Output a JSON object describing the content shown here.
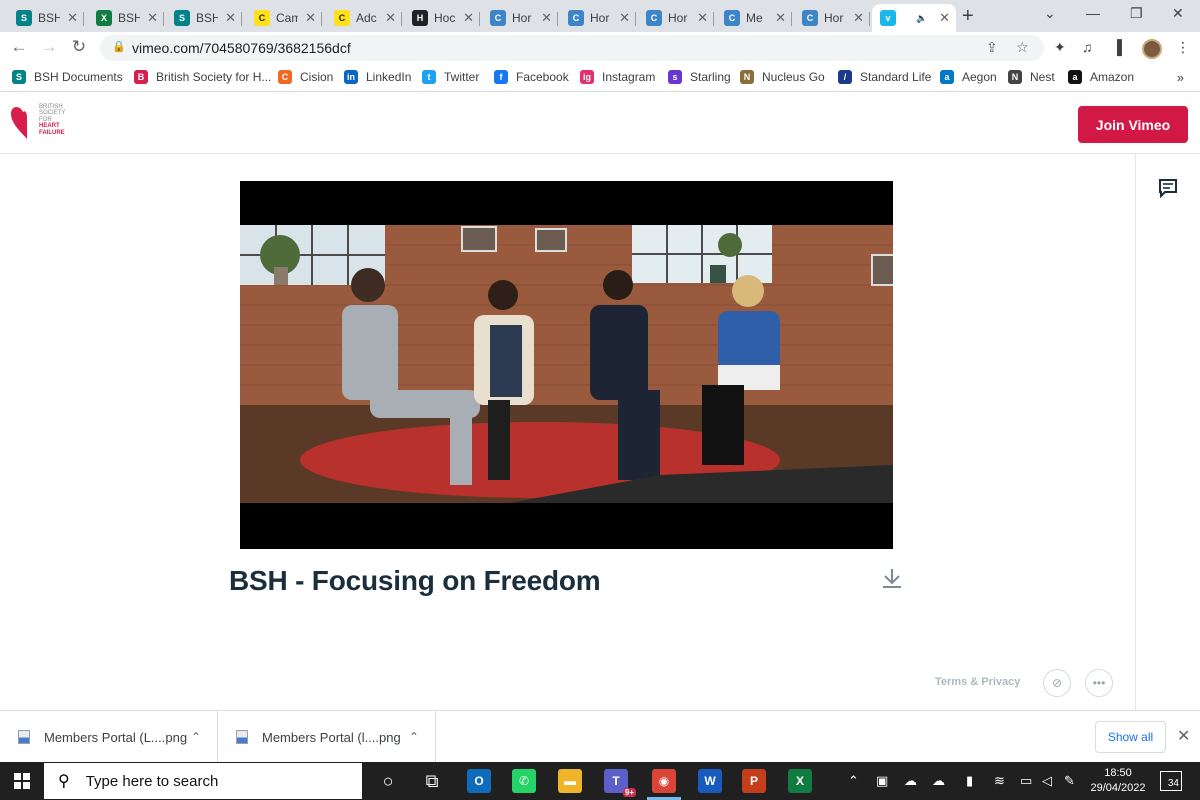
{
  "browser": {
    "tabs": [
      {
        "title": "BSH",
        "icon": "sharepoint-icon",
        "color": "#038387",
        "glyph": "S"
      },
      {
        "title": "BSH",
        "icon": "excel-icon",
        "color": "#107c41",
        "glyph": "X"
      },
      {
        "title": "BSH",
        "icon": "sharepoint-icon",
        "color": "#038387",
        "glyph": "S"
      },
      {
        "title": "Cam",
        "icon": "mailchimp-icon",
        "color": "#ffe01b",
        "glyph": "C"
      },
      {
        "title": "Adc",
        "icon": "mailchimp-icon",
        "color": "#ffe01b",
        "glyph": "C"
      },
      {
        "title": "Hoc",
        "icon": "shield-icon",
        "color": "#202124",
        "glyph": "H"
      },
      {
        "title": "Hor",
        "icon": "c-logo-icon",
        "color": "#3d85c6",
        "glyph": "C"
      },
      {
        "title": "Hor",
        "icon": "c-logo-icon",
        "color": "#3d85c6",
        "glyph": "C"
      },
      {
        "title": "Hor",
        "icon": "c-logo-icon",
        "color": "#3d85c6",
        "glyph": "C"
      },
      {
        "title": "Me",
        "icon": "c-logo-icon",
        "color": "#3d85c6",
        "glyph": "C"
      },
      {
        "title": "Hor",
        "icon": "c-logo-icon",
        "color": "#3d85c6",
        "glyph": "C"
      },
      {
        "title": "",
        "icon": "vimeo-icon",
        "color": "#1ab7ea",
        "glyph": "v",
        "active": true
      }
    ],
    "url": "vimeo.com/704580769/3682156dcf",
    "bookmarks": [
      {
        "label": "BSH Documents",
        "color": "#038387",
        "glyph": "S"
      },
      {
        "label": "British Society for H...",
        "color": "#d61f4b",
        "glyph": "B"
      },
      {
        "label": "Cision",
        "color": "#f26722",
        "glyph": "C"
      },
      {
        "label": "LinkedIn",
        "color": "#0a66c2",
        "glyph": "in"
      },
      {
        "label": "Twitter",
        "color": "#1da1f2",
        "glyph": "t"
      },
      {
        "label": "Facebook",
        "color": "#1877f2",
        "glyph": "f"
      },
      {
        "label": "Instagram",
        "color": "#e1306c",
        "glyph": "ig"
      },
      {
        "label": "Starling",
        "color": "#6935d3",
        "glyph": "s"
      },
      {
        "label": "Nucleus Go",
        "color": "#8a6d3b",
        "glyph": "N"
      },
      {
        "label": "Standard Life",
        "color": "#1d3a8a",
        "glyph": "/"
      },
      {
        "label": "Aegon",
        "color": "#0077c8",
        "glyph": "a"
      },
      {
        "label": "Nest",
        "color": "#444444",
        "glyph": "N"
      },
      {
        "label": "Amazon",
        "color": "#111111",
        "glyph": "a"
      }
    ],
    "bookmarks_more": "»"
  },
  "page": {
    "logo_lines": [
      "BRITISH",
      "SOCIETY",
      "FOR",
      "HEART",
      "FAILURE"
    ],
    "join_label": "Join Vimeo",
    "brand_color": "#d21945",
    "video_title": "BSH - Focusing on Freedom",
    "terms": "Terms & Privacy",
    "more_glyph": "•••"
  },
  "downloads": {
    "items": [
      {
        "name": "Members Portal (L....png"
      },
      {
        "name": "Members Portal (l....png"
      }
    ],
    "show_all": "Show all"
  },
  "taskbar": {
    "search_placeholder": "Type here to search",
    "apps": [
      {
        "name": "cortana-icon",
        "glyph": "○",
        "color": "transparent"
      },
      {
        "name": "task-view-icon",
        "glyph": "⧉",
        "color": "transparent"
      },
      {
        "name": "outlook-icon",
        "glyph": "O",
        "color": "#0f6cbd"
      },
      {
        "name": "whatsapp-icon",
        "glyph": "✆",
        "color": "#25d366"
      },
      {
        "name": "file-explorer-icon",
        "glyph": "▬",
        "color": "#f0b429"
      },
      {
        "name": "teams-icon",
        "glyph": "T",
        "color": "#5b5fc7",
        "badge": "9+"
      },
      {
        "name": "chrome-icon",
        "glyph": "◉",
        "color": "#db4437",
        "active": true
      },
      {
        "name": "word-icon",
        "glyph": "W",
        "color": "#185abd"
      },
      {
        "name": "powerpoint-icon",
        "glyph": "P",
        "color": "#c43e1c"
      },
      {
        "name": "excel-icon",
        "glyph": "X",
        "color": "#107c41"
      }
    ],
    "time": "18:50",
    "date": "29/04/2022",
    "notifications": "34"
  }
}
